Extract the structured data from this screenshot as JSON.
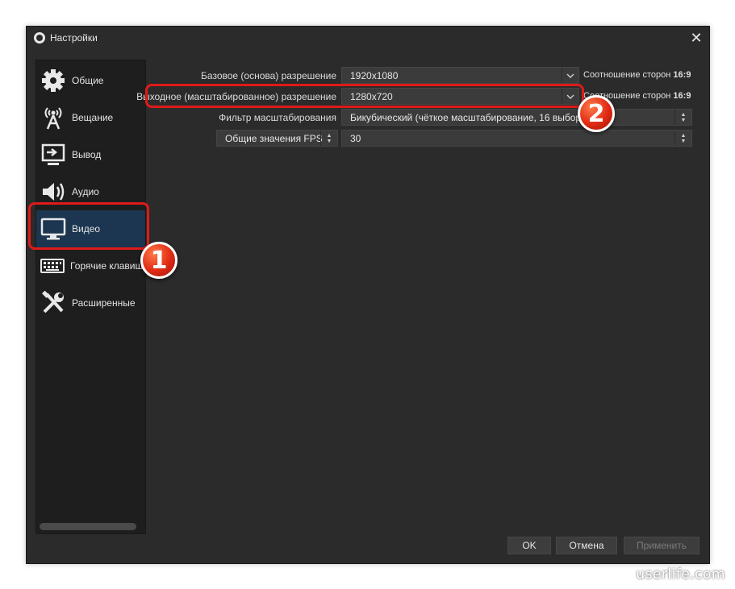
{
  "window": {
    "title": "Настройки",
    "close_glyph": "✕"
  },
  "sidebar": {
    "items": [
      {
        "label": "Общие",
        "icon": "gear-icon"
      },
      {
        "label": "Вещание",
        "icon": "broadcast-icon"
      },
      {
        "label": "Вывод",
        "icon": "output-icon"
      },
      {
        "label": "Аудио",
        "icon": "speaker-icon"
      },
      {
        "label": "Видео",
        "icon": "monitor-icon",
        "selected": true
      },
      {
        "label": "Горячие клавиши",
        "icon": "keyboard-icon"
      },
      {
        "label": "Расширенные",
        "icon": "tools-icon"
      }
    ]
  },
  "video": {
    "base_resolution_label": "Базовое (основа) разрешение",
    "base_resolution_value": "1920x1080",
    "base_aspect_label": "Соотношение сторон",
    "base_aspect_value": "16:9",
    "output_resolution_label": "Выходное (масштабированное) разрешение",
    "output_resolution_value": "1280x720",
    "output_aspect_label": "Соотношение сторон",
    "output_aspect_value": "16:9",
    "filter_label": "Фильтр масштабирования",
    "filter_value": "Бикубический (чёткое масштабирование, 16 выборок)",
    "fps_type_label": "Общие значения FPS",
    "fps_value": "30"
  },
  "buttons": {
    "ok": "OK",
    "cancel": "Отмена",
    "apply": "Применить"
  },
  "annotations": {
    "step1": "1",
    "step2": "2"
  },
  "watermark": "userlife.com",
  "colors": {
    "highlight": "#e01a1a",
    "selected_bg": "#1c3550"
  }
}
